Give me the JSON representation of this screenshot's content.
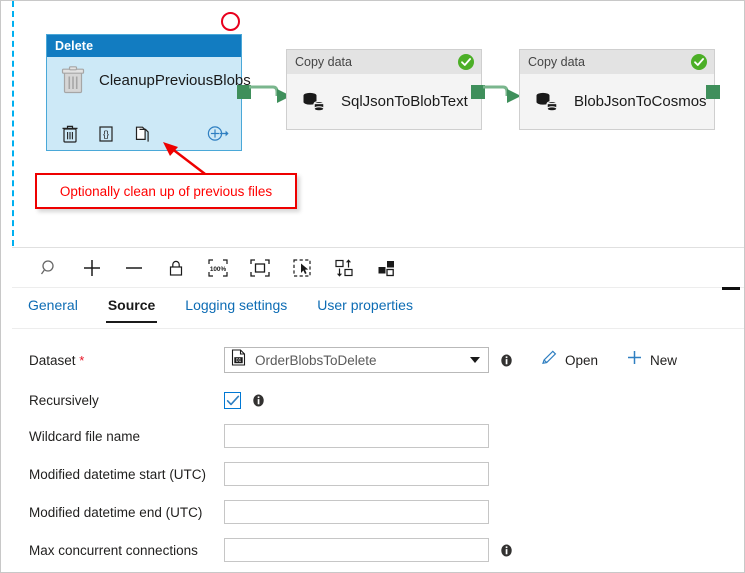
{
  "canvas": {
    "nodes": [
      {
        "type_label": "Delete",
        "name": "CleanupPreviousBlobs",
        "icon": "trash-icon",
        "actions": [
          "delete-icon",
          "code-icon",
          "clone-icon",
          "add-output-icon"
        ]
      },
      {
        "type_label": "Copy data",
        "name": "SqlJsonToBlobText",
        "icon": "database-copy-icon",
        "status": "success"
      },
      {
        "type_label": "Copy data",
        "name": "BlobJsonToCosmos",
        "icon": "database-copy-icon",
        "status": "success"
      }
    ],
    "annotation": {
      "callout_text": "Optionally clean up of previous files",
      "circle_color": "#e8001d",
      "callout_color": "#ff0000"
    }
  },
  "toolbar": {
    "buttons": [
      {
        "name": "zoom-search",
        "label": "Search"
      },
      {
        "name": "zoom-in",
        "label": "Zoom in"
      },
      {
        "name": "zoom-out",
        "label": "Zoom out"
      },
      {
        "name": "lock",
        "label": "Lock"
      },
      {
        "name": "zoom-100",
        "label": "100%",
        "text": "100%"
      },
      {
        "name": "zoom-to-fit",
        "label": "Zoom to fit"
      },
      {
        "name": "select-tool",
        "label": "Select"
      },
      {
        "name": "auto-align",
        "label": "Auto align"
      },
      {
        "name": "layout",
        "label": "Layout"
      }
    ],
    "minimize_label": "Minimize"
  },
  "tabs": [
    {
      "label": "General",
      "active": false
    },
    {
      "label": "Source",
      "active": true
    },
    {
      "label": "Logging settings",
      "active": false
    },
    {
      "label": "User properties",
      "active": false
    }
  ],
  "form": {
    "dataset": {
      "label": "Dataset",
      "required_marker": "*",
      "value": "OrderBlobsToDelete",
      "icon": "binary-file-icon",
      "open_label": "Open",
      "new_label": "New"
    },
    "recursively": {
      "label": "Recursively",
      "checked": true
    },
    "wildcard_file_name": {
      "label": "Wildcard file name",
      "value": "",
      "placeholder": ""
    },
    "modified_start": {
      "label": "Modified datetime start (UTC)",
      "value": "",
      "placeholder": ""
    },
    "modified_end": {
      "label": "Modified datetime end (UTC)",
      "value": "",
      "placeholder": ""
    },
    "max_concurrent": {
      "label": "Max concurrent connections",
      "value": "",
      "placeholder": ""
    }
  },
  "colors": {
    "header_blue": "#127cc1",
    "node_body_blue": "#cde9f7",
    "connector_green": "#3f8f5b",
    "link_blue": "#0d6cb4",
    "accent_red": "#ff0000"
  }
}
